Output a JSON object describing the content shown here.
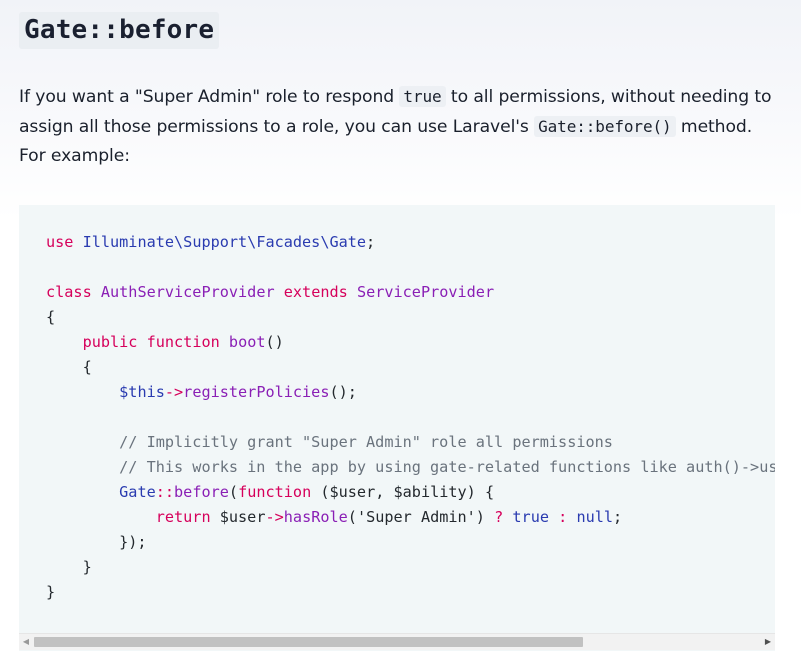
{
  "heading": "Gate::before",
  "paragraph": {
    "part1": "If you want a \"Super Admin\" role to respond ",
    "code1": "true",
    "part2": " to all permissions, without needing to assign all those permissions to a role, you can use Laravel's ",
    "code2": "Gate::before()",
    "part3": " method. For example:"
  },
  "code": {
    "l1_use": "use",
    "l1_ns": "Illuminate\\Support\\Facades\\Gate",
    "l1_end": ";",
    "l3_class": "class",
    "l3_name": "AuthServiceProvider",
    "l3_extends": "extends",
    "l3_parent": "ServiceProvider",
    "l4_brace": "{",
    "l5_indent": "    ",
    "l5_public": "public",
    "l5_function": "function",
    "l5_name": "boot",
    "l5_parens": "()",
    "l6_brace": "    {",
    "l7_indent": "        ",
    "l7_this": "$this",
    "l7_arrow": "->",
    "l7_method": "registerPolicies",
    "l7_end": "();",
    "l9_comment": "        // Implicitly grant \"Super Admin\" role all permissions",
    "l10_comment": "        // This works in the app by using gate-related functions like auth()->user->can() and @can()",
    "l11_indent": "        ",
    "l11_gate": "Gate",
    "l11_sep": "::",
    "l11_before": "before",
    "l11_open": "(",
    "l11_function": "function",
    "l11_args": " ($user, $ability) {",
    "l12_indent": "            ",
    "l12_return": "return",
    "l12_user": " $user",
    "l12_arrow": "->",
    "l12_method": "hasRole",
    "l12_arg": "('Super Admin') ",
    "l12_q": "?",
    "l12_true": " true ",
    "l12_colon": ":",
    "l12_null": " null",
    "l12_end": ";",
    "l13_close": "        });",
    "l14_brace": "    }",
    "l15_brace": "}"
  },
  "scrollbar": {
    "left_arrow": "◀",
    "right_arrow": "▶"
  }
}
